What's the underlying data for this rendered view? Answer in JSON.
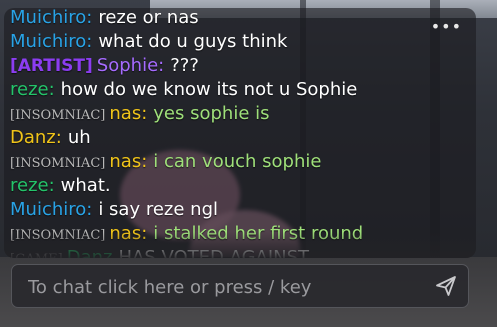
{
  "chat": {
    "menu_icon": "more-horizontal-icon",
    "messages": [
      {
        "tag": "",
        "tag_color": "",
        "name": "Muichiro:",
        "name_color": "#29a3e6",
        "text": "reze or nas"
      },
      {
        "tag": "",
        "tag_color": "",
        "name": "Muichiro:",
        "name_color": "#29a3e6",
        "text": "what do u guys think"
      },
      {
        "tag": "[ARTIST]",
        "tag_color": "#8b3df0",
        "name": "Sophie:",
        "name_color": "#a66bff",
        "text": "???"
      },
      {
        "tag": "",
        "tag_color": "",
        "name": "reze:",
        "name_color": "#24c46a",
        "text": "how do we know its not u Sophie"
      },
      {
        "tag": "[INSOMNIAC]",
        "tag_color": "#b9b9b9",
        "name": "nas:",
        "name_color": "#f0c419",
        "text": "yes sophie is",
        "text_color": "#9fe07a"
      },
      {
        "tag": "",
        "tag_color": "",
        "name": "Danz:",
        "name_color": "#f0c419",
        "text": "uh"
      },
      {
        "tag": "[INSOMNIAC]",
        "tag_color": "#b9b9b9",
        "name": "nas:",
        "name_color": "#f0c419",
        "text": "i can vouch sophie",
        "text_color": "#9fe07a"
      },
      {
        "tag": "",
        "tag_color": "",
        "name": "reze:",
        "name_color": "#24c46a",
        "text": "what."
      },
      {
        "tag": "",
        "tag_color": "",
        "name": "Muichiro:",
        "name_color": "#29a3e6",
        "text": "i say reze ngl"
      },
      {
        "tag": "[INSOMNIAC]",
        "tag_color": "#b9b9b9",
        "name": "nas:",
        "name_color": "#f0c419",
        "text": "i stalked her first round",
        "text_color": "#9fe07a"
      },
      {
        "tag": "[GAME]",
        "tag_color": "#8a8a8a",
        "name": "Danz",
        "name_color": "#24c46a",
        "text": "HAS VOTED AGAINST",
        "text_color": "#e8e8e8"
      }
    ]
  },
  "input": {
    "placeholder": "To chat click here or press / key",
    "send_icon": "send-icon"
  },
  "colors": {
    "input_border": "#55565b",
    "placeholder": "#9a9a9e"
  }
}
